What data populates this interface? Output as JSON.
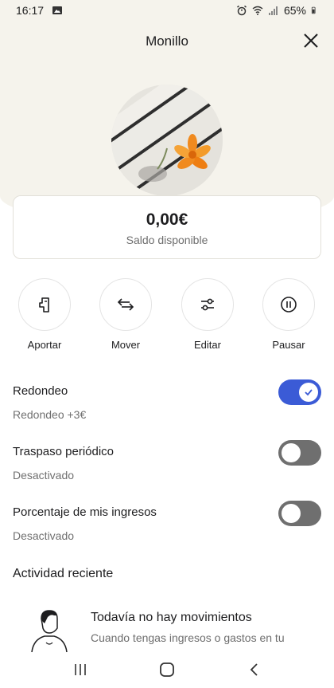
{
  "status_bar": {
    "time": "16:17",
    "battery": "65%"
  },
  "header": {
    "title": "Monillo"
  },
  "balance": {
    "amount": "0,00€",
    "label": "Saldo disponible"
  },
  "actions": [
    {
      "label": "Aportar",
      "icon": "hand-deposit-icon"
    },
    {
      "label": "Mover",
      "icon": "transfer-arrows-icon"
    },
    {
      "label": "Editar",
      "icon": "sliders-icon"
    },
    {
      "label": "Pausar",
      "icon": "pause-icon"
    }
  ],
  "settings": [
    {
      "title": "Redondeo",
      "subtitle": "Redondeo +3€",
      "enabled": true
    },
    {
      "title": "Traspaso periódico",
      "subtitle": "Desactivado",
      "enabled": false
    },
    {
      "title": "Porcentaje de mis ingresos",
      "subtitle": "Desactivado",
      "enabled": false
    }
  ],
  "recent": {
    "title": "Actividad reciente",
    "empty_title": "Todavía no hay movimientos",
    "empty_subtitle": "Cuando tengas ingresos o gastos en tu"
  },
  "colors": {
    "accent": "#3b5bd6",
    "hero_bg": "#f5f3ec",
    "toggle_off": "#6f6f6f"
  }
}
